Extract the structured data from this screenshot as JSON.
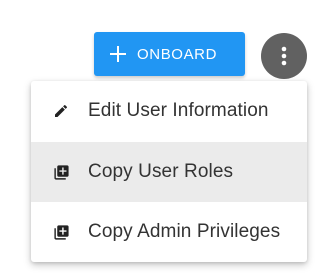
{
  "toolbar": {
    "onboard_label": "ONBOARD",
    "onboard_icon": "plus-icon",
    "more_icon": "more-vertical-icon"
  },
  "menu": {
    "items": [
      {
        "label": "Edit User Information",
        "icon": "pencil-icon",
        "selected": false
      },
      {
        "label": "Copy User Roles",
        "icon": "library-add-icon",
        "selected": true
      },
      {
        "label": "Copy Admin Privileges",
        "icon": "library-add-icon",
        "selected": false
      }
    ]
  },
  "colors": {
    "primary": "#2196f3",
    "more_button": "#616161",
    "selected_bg": "#ebebeb",
    "text": "#333333"
  }
}
